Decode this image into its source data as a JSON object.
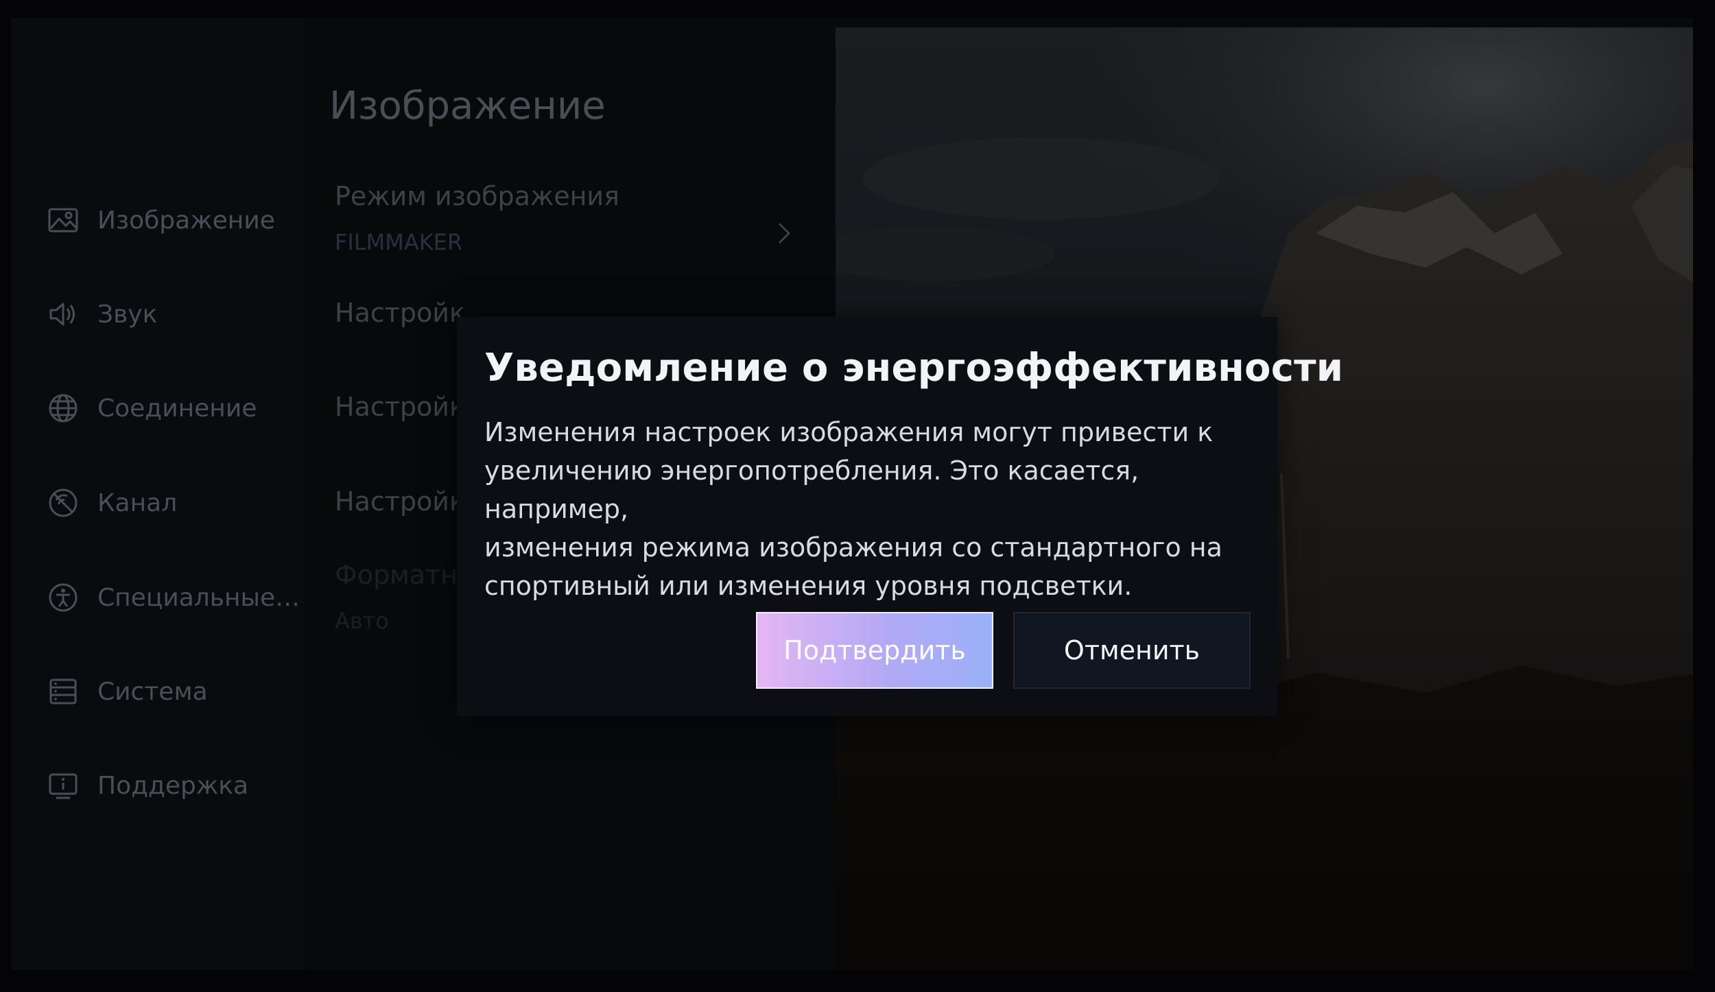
{
  "sidebar": {
    "items": [
      {
        "label": "Изображение",
        "icon": "picture-icon"
      },
      {
        "label": "Звук",
        "icon": "speaker-icon"
      },
      {
        "label": "Соединение",
        "icon": "globe-icon"
      },
      {
        "label": "Канал",
        "icon": "channel-icon"
      },
      {
        "label": "Специальные ...",
        "icon": "accessibility-icon"
      },
      {
        "label": "Система",
        "icon": "system-icon"
      },
      {
        "label": "Поддержка",
        "icon": "support-icon"
      }
    ]
  },
  "panel": {
    "title": "Изображение",
    "items": [
      {
        "label": "Режим изображения",
        "value": "FILMMAKER"
      },
      {
        "label": "Настройк"
      },
      {
        "label": "Настройк"
      },
      {
        "label": "Настройк"
      },
      {
        "label": "Форматн",
        "value": "Авто"
      }
    ]
  },
  "dialog": {
    "title": "Уведомление о энергоэффективности",
    "body_lines": [
      "Изменения настроек изображения могут привести к",
      "увеличению энергопотребления. Это касается, например,",
      "изменения режима изображения со стандартного на",
      "спортивный или изменения уровня подсветки."
    ],
    "confirm_label": "Подтвердить",
    "cancel_label": "Отменить"
  },
  "colors": {
    "accent_gradient_start": "#e4b6f2",
    "accent_gradient_end": "#9ab1f7",
    "dialog_bg": "#0c0e14"
  }
}
